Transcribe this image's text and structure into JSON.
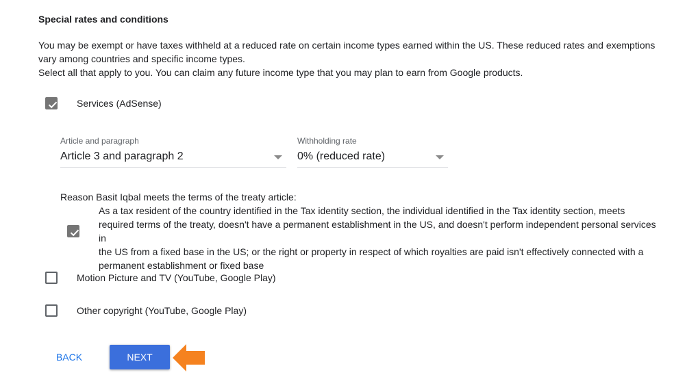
{
  "section": {
    "title": "Special rates and conditions",
    "description_line1": "You may be exempt or have taxes withheld at a reduced rate on certain income types earned within the US. These reduced rates and exemptions",
    "description_line2": "vary among countries and specific income types.",
    "description_line3": "Select all that apply to you. You can claim any future income type that you may plan to earn from Google products."
  },
  "options": {
    "services": {
      "label": "Services (AdSense)",
      "checked": true
    },
    "motion_picture": {
      "label": "Motion Picture and TV (YouTube, Google Play)",
      "checked": false
    },
    "other_copyright": {
      "label": "Other copyright (YouTube, Google Play)",
      "checked": false
    }
  },
  "services_details": {
    "article_label": "Article and paragraph",
    "article_value": "Article 3 and paragraph 2",
    "rate_label": "Withholding rate",
    "rate_value": "0% (reduced rate)",
    "reason_heading": "Reason Basit Iqbal meets the terms of the treaty article:",
    "reason_text_line1": "As a tax resident of the country identified in the Tax identity section, the individual identified in the Tax identity section, meets",
    "reason_text_line2": "required terms of the treaty, doesn't have a permanent establishment in the US, and doesn't perform independent personal services in",
    "reason_text_line3": "the US from a fixed base in the US; or the right or property in respect of which royalties are paid isn't effectively connected with a",
    "reason_text_line4": "permanent establishment or fixed base",
    "reason_checked": true
  },
  "buttons": {
    "back": "BACK",
    "next": "NEXT"
  },
  "colors": {
    "primary_button": "#3b6fdc",
    "link_text": "#1a73e8",
    "checked_box": "#757575",
    "annotation_arrow": "#f5821f"
  },
  "icons": {
    "checkmark": "check-icon",
    "dropdown": "caret-down-icon",
    "annotation": "arrow-left-icon"
  }
}
